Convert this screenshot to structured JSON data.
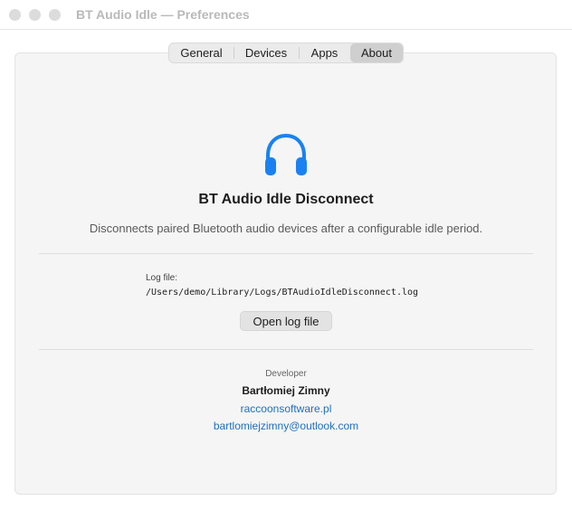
{
  "window": {
    "title": "BT Audio Idle — Preferences"
  },
  "tabs": {
    "general": "General",
    "devices": "Devices",
    "apps": "Apps",
    "about": "About",
    "selected": "About"
  },
  "about": {
    "icon": "headphones-icon",
    "accent_color": "#1a82f0",
    "app_name": "BT Audio Idle Disconnect",
    "description": "Disconnects paired Bluetooth audio devices after a configurable idle period.",
    "log_label": "Log file:",
    "log_path": "/Users/demo/Library/Logs/BTAudioIdleDisconnect.log",
    "open_log_button": "Open log file",
    "developer_label": "Developer",
    "developer_name": "Bartłomiej Zimny",
    "website": "raccoonsoftware.pl",
    "email": "bartlomiejzimny@outlook.com",
    "link_color": "#1f6fc1"
  }
}
